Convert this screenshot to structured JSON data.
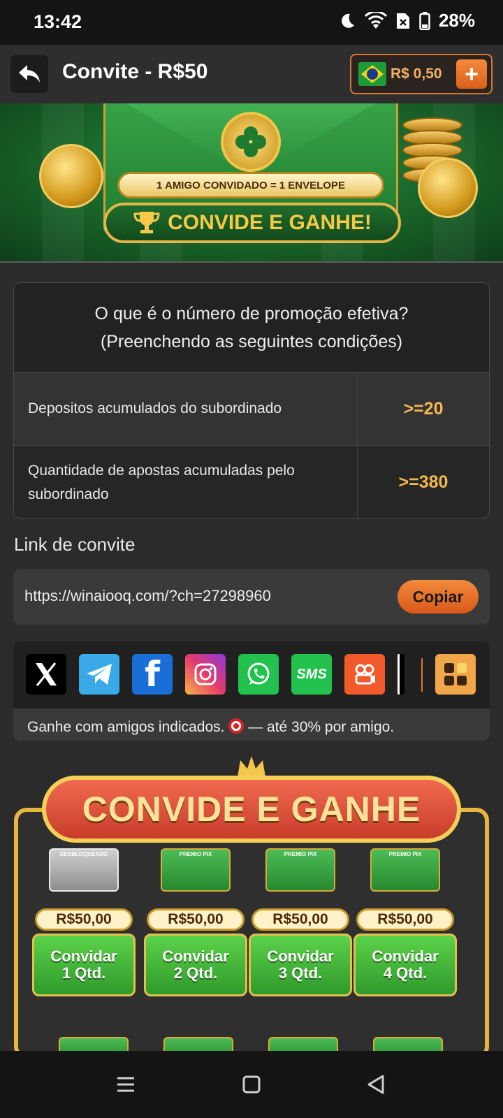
{
  "status_bar": {
    "time": "13:42",
    "battery_percent": "28%",
    "icons": [
      "moon-icon",
      "wifi-icon",
      "no-sim-icon",
      "battery-icon"
    ]
  },
  "header": {
    "title": "Convite - R$50",
    "balance": "R$ 0,50",
    "add_label": "+",
    "back_icon": "back-arrow-icon",
    "flag_icon": "brazil-flag-icon"
  },
  "banner": {
    "tagline": "1 AMIGO CONVIDADO = 1 ENVELOPE",
    "headline": "CONVIDE E GANHE!"
  },
  "conditions": {
    "title_line1": "O que é o número de promoção efetiva?",
    "title_line2": "(Preenchendo as seguintes condições)",
    "rows": [
      {
        "label": "Depositos acumulados do subordinado",
        "value": ">=20"
      },
      {
        "label": "Quantidade de apostas acumuladas pelo subordinado",
        "value": ">=380"
      }
    ]
  },
  "invite": {
    "label": "Link de convite",
    "url": "https://winaiooq.com/?ch=27298960",
    "copy_label": "Copiar"
  },
  "share": {
    "icons": [
      "x-icon",
      "telegram-icon",
      "facebook-icon",
      "instagram-icon",
      "whatsapp-icon",
      "sms-icon",
      "kwai-icon",
      "tiktok-icon",
      "more-apps-icon"
    ],
    "sms_label": "SMS",
    "caption_before": "Ganhe com amigos indicados.",
    "caption_after": "— até 30% por amigo."
  },
  "promo": {
    "title": "CONVIDE E GANHE",
    "rewards": [
      {
        "envelope_label": "DESBLOQUEADO",
        "amount": "R$50,00",
        "action": "Convidar",
        "qty": "1 Qtd.",
        "locked": true
      },
      {
        "envelope_label": "PREMIO PIX",
        "amount": "R$50,00",
        "action": "Convidar",
        "qty": "2 Qtd.",
        "locked": false
      },
      {
        "envelope_label": "PREMIO PIX",
        "amount": "R$50,00",
        "action": "Convidar",
        "qty": "3 Qtd.",
        "locked": false
      },
      {
        "envelope_label": "PREMIO PIX",
        "amount": "R$50,00",
        "action": "Convidar",
        "qty": "4 Qtd.",
        "locked": false
      }
    ]
  },
  "nav": {
    "icons": [
      "recents-icon",
      "home-icon",
      "back-icon"
    ]
  },
  "colors": {
    "accent": "#e8772c",
    "gold": "#f2b84e",
    "green": "#2f9a2c",
    "background": "#2b2b2b"
  }
}
